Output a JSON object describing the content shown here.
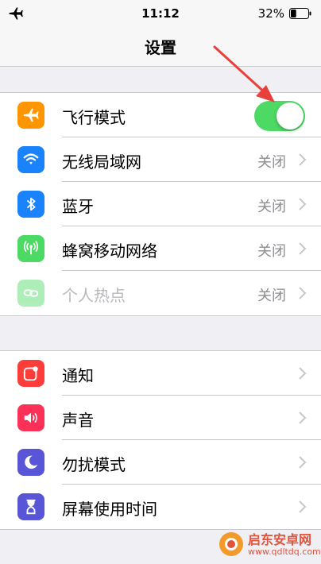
{
  "status_bar": {
    "time": "11:12",
    "battery_percent": "32%",
    "battery_level": 0.32
  },
  "nav": {
    "title": "设置"
  },
  "group1": {
    "rows": [
      {
        "label": "飞行模式",
        "icon": "airplane-icon",
        "icon_color": "#ff9500",
        "toggle_on": true
      },
      {
        "label": "无线局域网",
        "value": "关闭",
        "icon": "wifi-icon",
        "icon_color": "#1a82fb"
      },
      {
        "label": "蓝牙",
        "value": "关闭",
        "icon": "bluetooth-icon",
        "icon_color": "#1a82fb"
      },
      {
        "label": "蜂窝移动网络",
        "value": "关闭",
        "icon": "cellular-icon",
        "icon_color": "#4cd964"
      },
      {
        "label": "个人热点",
        "value": "关闭",
        "icon": "hotspot-icon",
        "icon_color": "#4cd964",
        "disabled": true
      }
    ]
  },
  "group2": {
    "rows": [
      {
        "label": "通知",
        "icon": "notifications-icon",
        "icon_color": "#fc3d39"
      },
      {
        "label": "声音",
        "icon": "sound-icon",
        "icon_color": "#fc3158"
      },
      {
        "label": "勿扰模式",
        "icon": "moon-icon",
        "icon_color": "#5856d6"
      },
      {
        "label": "屏幕使用时间",
        "icon": "hourglass-icon",
        "icon_color": "#5856d6"
      }
    ]
  },
  "watermark": {
    "name": "启东安卓网",
    "url": "www.qdltdq.com"
  },
  "colors": {
    "toggle_on": "#4cd964",
    "annotation_arrow": "#e8403a"
  }
}
